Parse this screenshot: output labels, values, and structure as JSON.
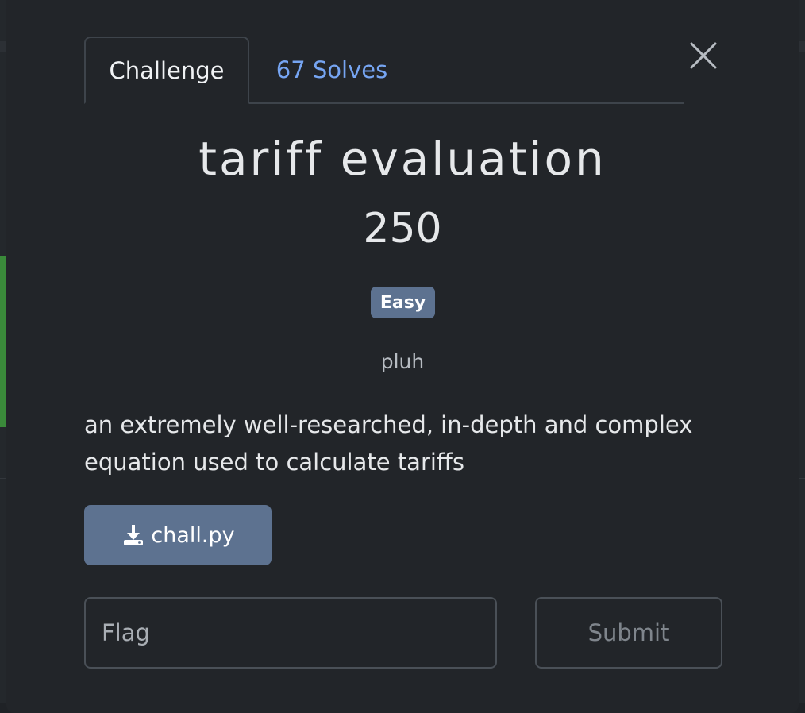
{
  "tabs": [
    {
      "label": "Challenge",
      "active": true
    },
    {
      "label": "67 Solves",
      "active": false
    }
  ],
  "challenge": {
    "name": "tariff evaluation",
    "points": "250",
    "difficulty": "Easy",
    "author": "pluh",
    "description": "an extremely well-researched, in-depth and complex equation used to calculate tariffs"
  },
  "download": {
    "filename": "chall.py",
    "icon": "download-icon"
  },
  "flag": {
    "placeholder": "Flag",
    "value": ""
  },
  "submit": {
    "label": "Submit"
  },
  "colors": {
    "modal_bg": "#222529",
    "accent_link": "#76a5f2",
    "badge_bg": "#5d7290",
    "button_bg": "#5d7290",
    "text": "#e6e8ea"
  }
}
